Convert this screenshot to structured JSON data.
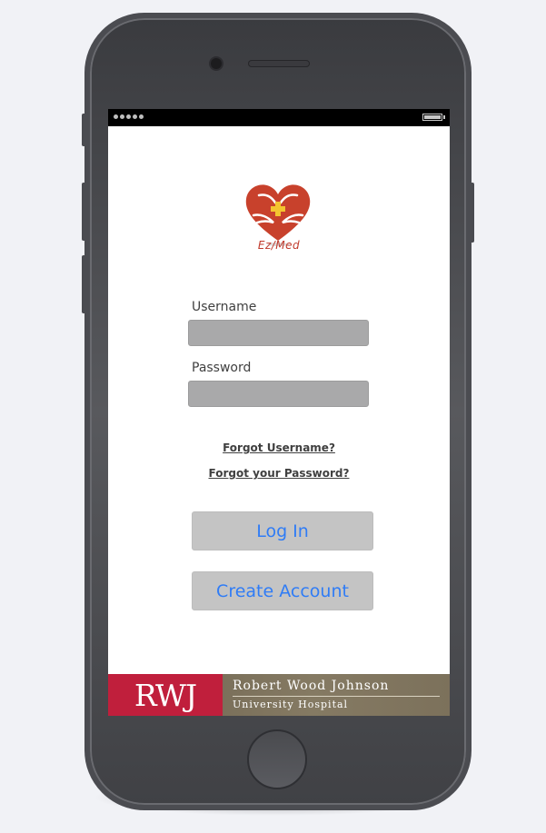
{
  "logo": {
    "text": "Ez/Med",
    "icon": "heart-hands-cross-icon"
  },
  "form": {
    "username_label": "Username",
    "username_value": "",
    "password_label": "Password",
    "password_value": ""
  },
  "links": {
    "forgot_username": "Forgot Username?",
    "forgot_password": "Forgot your Password?"
  },
  "buttons": {
    "login": "Log In",
    "create_account": "Create Account"
  },
  "banner": {
    "abbrev": "RWJ",
    "line1": "Robert Wood Johnson",
    "line2": "University Hospital"
  },
  "colors": {
    "button_text": "#2f7cf6",
    "banner_red": "#c01f3c",
    "logo_red": "#c0392b"
  }
}
